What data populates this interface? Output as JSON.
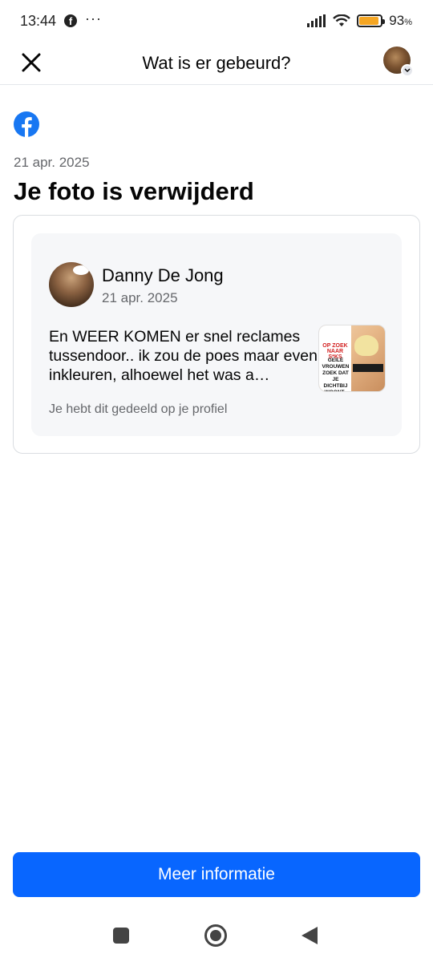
{
  "status_bar": {
    "time": "13:44",
    "app_icon": "facebook-icon",
    "more": "···",
    "battery_percent": "93",
    "battery_unit": "%",
    "battery_level": 0.93,
    "battery_color": "#f5a623"
  },
  "top_bar": {
    "title": "Wat is er gebeurd?",
    "close_icon": "close-icon",
    "profile_icon": "avatar"
  },
  "notice": {
    "logo": "facebook-logo-icon",
    "date": "21 apr. 2025",
    "headline": "Je foto is verwijderd"
  },
  "post": {
    "author": "Danny De Jong",
    "date": "21 apr. 2025",
    "text": "En WEER KOMEN er snel reclames tussendoor.. ik zou de poes maar even inkleuren, alhoewel het was a…",
    "thumbnail_text_red": "OP ZOEK NAAR S*KS",
    "thumbnail_text_black": "GEILE VROUWEN ZOEK DAT JE DICHTBIJ WOONT..",
    "shared_note": "Je hebt dit gedeeld op je profiel"
  },
  "actions": {
    "more_info_label": "Meer informatie"
  },
  "colors": {
    "brand_blue": "#0866ff",
    "facebook_blue": "#1877f2",
    "secondary_text": "#65676b"
  },
  "nav_bar": {
    "recents_icon": "square-icon",
    "home_icon": "circle-home-icon",
    "back_icon": "triangle-back-icon"
  }
}
